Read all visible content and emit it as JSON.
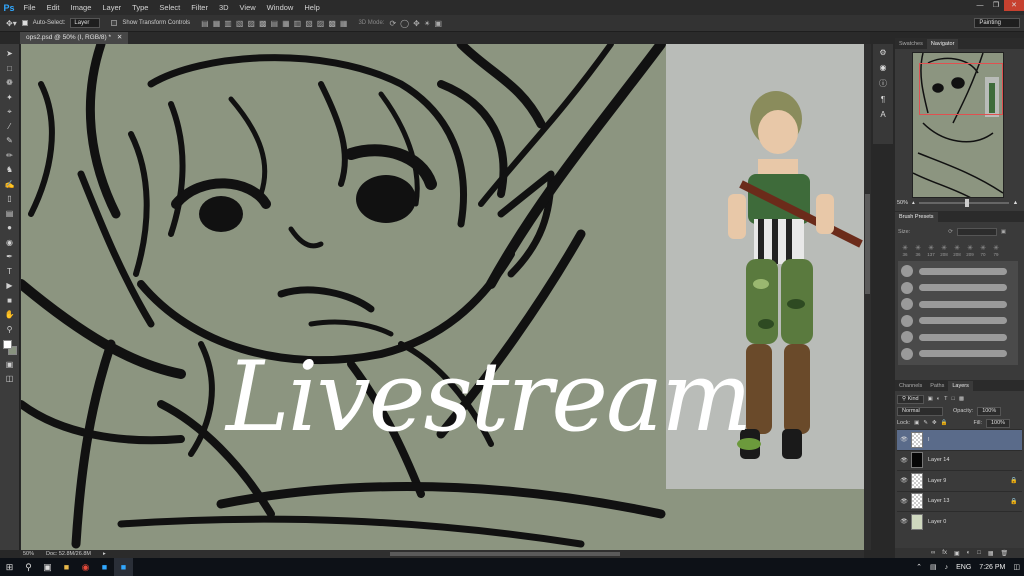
{
  "app": {
    "logo": "Ps",
    "menus": [
      "File",
      "Edit",
      "Image",
      "Layer",
      "Type",
      "Select",
      "Filter",
      "3D",
      "View",
      "Window",
      "Help"
    ]
  },
  "options": {
    "auto_select_label": "Auto-Select:",
    "auto_select_value": "Layer",
    "transform_label": "Show Transform Controls",
    "mode_label": "3D Mode:",
    "workspace": "Painting"
  },
  "document": {
    "tab_label": "ops2.psd @ 50% (I, RGB/8) *",
    "zoom": "50%",
    "doc_size": "Doc: 52.8M/26.8M",
    "overlay_text": "Livestream"
  },
  "panels": {
    "nav_tabs": [
      "Swatches",
      "Navigator"
    ],
    "nav_zoom": "50%",
    "brush_title": "Brush Presets",
    "brush_size_label": "Size:",
    "brush_tips": [
      "36",
      "36",
      "137",
      "208",
      "208",
      "209",
      "70",
      "79"
    ],
    "layer_tabs": [
      "Channels",
      "Paths",
      "Layers"
    ],
    "kind_label": "Kind",
    "blend_mode": "Normal",
    "opacity_label": "Opacity:",
    "opacity_value": "100%",
    "lock_label": "Lock:",
    "fill_label": "Fill:",
    "fill_value": "100%",
    "layers": [
      {
        "name": "I",
        "thumb": "checker",
        "active": true,
        "locked": false
      },
      {
        "name": "Layer 14",
        "thumb": "black",
        "active": false,
        "locked": false
      },
      {
        "name": "Layer 9",
        "thumb": "checker",
        "active": false,
        "locked": true
      },
      {
        "name": "Layer 13",
        "thumb": "checker",
        "active": false,
        "locked": true
      },
      {
        "name": "Layer 0",
        "thumb": "green",
        "active": false,
        "locked": false
      }
    ]
  },
  "taskbar": {
    "lang": "ENG",
    "time": "7:26 PM"
  },
  "colors": {
    "canvas_bg": "#8c9580",
    "ps_blue": "#31a8ff",
    "active_layer": "#5a6b8a",
    "nav_frame": "#e05050"
  }
}
